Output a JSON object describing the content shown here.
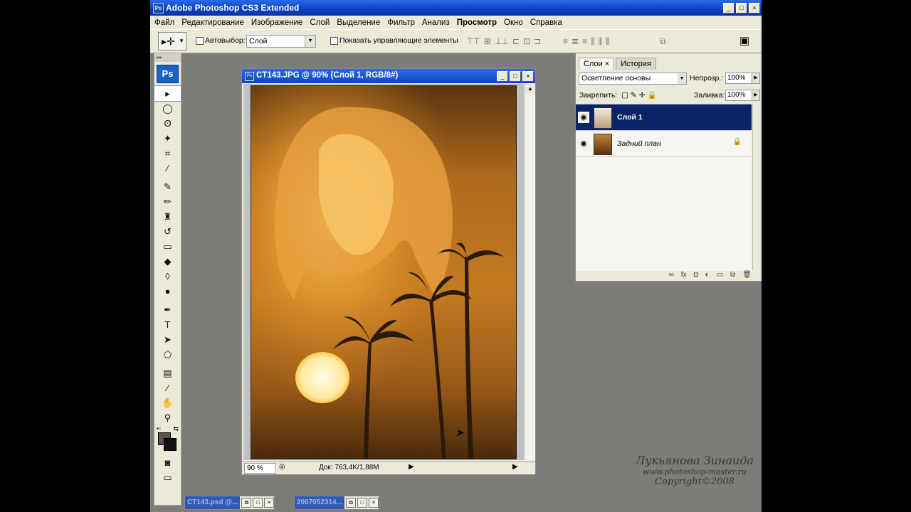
{
  "app": {
    "title": "Adobe Photoshop CS3 Extended",
    "badge": "Ps",
    "win_min": "_",
    "win_max": "□",
    "win_close": "×"
  },
  "menubar": [
    "Файл",
    "Редактирование",
    "Изображение",
    "Слой",
    "Выделение",
    "Фильтр",
    "Анализ",
    "Просмотр",
    "Окно",
    "Справка"
  ],
  "options": {
    "autoselect_label": "Автовыбор:",
    "autoselect_value": "Слой",
    "show_controls_label": "Показать управляющие элементы"
  },
  "toolbox": {
    "logo": "Ps",
    "tools": [
      {
        "name": "move-tool-icon",
        "glyph": "▸"
      },
      {
        "name": "elliptical-marquee-icon",
        "glyph": "◯"
      },
      {
        "name": "lasso-icon",
        "glyph": "ʘ"
      },
      {
        "name": "magic-wand-icon",
        "glyph": "✦"
      },
      {
        "name": "crop-icon",
        "glyph": "⌗"
      },
      {
        "name": "eyedropper-icon",
        "glyph": "⁄"
      },
      {
        "name": "healing-brush-icon",
        "glyph": "✎"
      },
      {
        "name": "brush-icon",
        "glyph": "✏"
      },
      {
        "name": "clone-stamp-icon",
        "glyph": "♜"
      },
      {
        "name": "history-brush-icon",
        "glyph": "↺"
      },
      {
        "name": "eraser-icon",
        "glyph": "▭"
      },
      {
        "name": "paint-bucket-icon",
        "glyph": "◆"
      },
      {
        "name": "blur-icon",
        "glyph": "◊"
      },
      {
        "name": "dodge-icon",
        "glyph": "●"
      },
      {
        "name": "pen-icon",
        "glyph": "✒"
      },
      {
        "name": "type-icon",
        "glyph": "T"
      },
      {
        "name": "path-selection-icon",
        "glyph": "➤"
      },
      {
        "name": "shape-icon",
        "glyph": "⬠"
      },
      {
        "name": "notes-icon",
        "glyph": "▤"
      },
      {
        "name": "color-sampler-icon",
        "glyph": "⁄"
      },
      {
        "name": "hand-icon",
        "glyph": "✋"
      },
      {
        "name": "zoom-icon",
        "glyph": "⚲"
      }
    ],
    "foreground_color": "#5c5449",
    "background_color": "#111111"
  },
  "document": {
    "title": "CT143.JPG @ 90% (Слой 1, RGB/8#)",
    "badge": "Ps",
    "zoom": "90 %",
    "info": "Док: 763,4K/1,88M"
  },
  "layers_panel": {
    "tabs": [
      "Слои ×",
      "История"
    ],
    "blend_mode": "Осветление основы",
    "opacity_label": "Непрозр.:",
    "opacity_value": "100%",
    "lock_label": "Закрепить:",
    "fill_label": "Заливка:",
    "fill_value": "100%",
    "layers": [
      {
        "name": "Слой 1",
        "selected": true,
        "locked": false
      },
      {
        "name": "Задний план",
        "selected": false,
        "locked": true
      }
    ],
    "footer_icons": [
      "link-icon",
      "fx-icon",
      "mask-icon",
      "adjustment-icon",
      "group-icon",
      "new-layer-icon",
      "trash-icon"
    ]
  },
  "credits": {
    "author": "Лукьянова Зинаида",
    "site": "www.photoshop-master.ru",
    "copyright": "Copyright©2008"
  },
  "taskbar": [
    {
      "label": "CT143.psd @..."
    },
    {
      "label": "2007052314..."
    }
  ]
}
